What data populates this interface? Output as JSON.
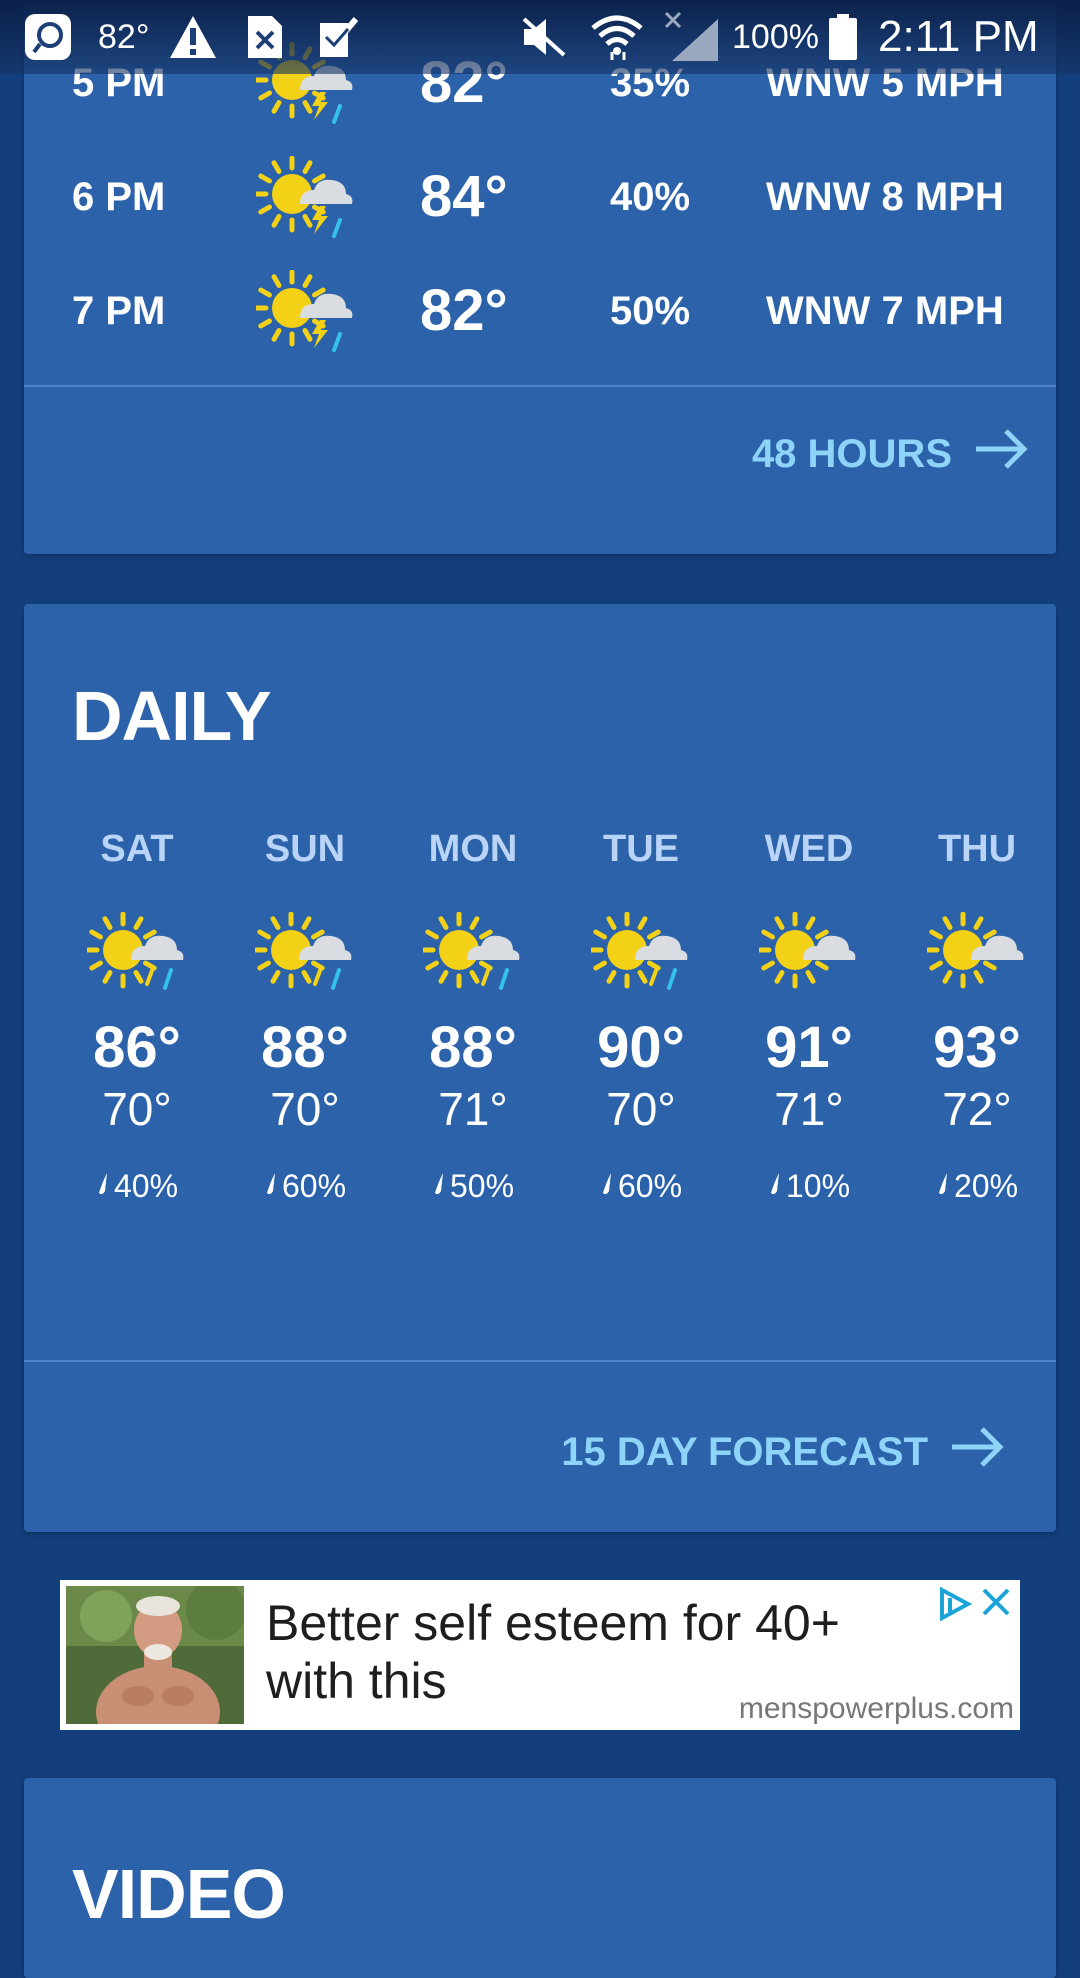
{
  "status_bar": {
    "temp": "82°",
    "battery": "100%",
    "time": "2:11 PM"
  },
  "hourly": {
    "rows": [
      {
        "time": "5 PM",
        "icon": "thunderstorm-sun-icon",
        "temp": "82°",
        "precip": "35%",
        "wind": "WNW 5 MPH"
      },
      {
        "time": "6 PM",
        "icon": "thunderstorm-sun-icon",
        "temp": "84°",
        "precip": "40%",
        "wind": "WNW 8 MPH"
      },
      {
        "time": "7 PM",
        "icon": "thunderstorm-sun-icon",
        "temp": "82°",
        "precip": "50%",
        "wind": "WNW 7 MPH"
      }
    ],
    "link_label": "48 HOURS"
  },
  "daily": {
    "title": "DAILY",
    "days": [
      {
        "day": "SAT",
        "icon": "rain-sun-icon",
        "high": "86°",
        "low": "70°",
        "precip": "40%"
      },
      {
        "day": "SUN",
        "icon": "rain-sun-icon",
        "high": "88°",
        "low": "70°",
        "precip": "60%"
      },
      {
        "day": "MON",
        "icon": "rain-sun-icon",
        "high": "88°",
        "low": "71°",
        "precip": "50%"
      },
      {
        "day": "TUE",
        "icon": "rain-sun-icon",
        "high": "90°",
        "low": "70°",
        "precip": "60%"
      },
      {
        "day": "WED",
        "icon": "partly-cloudy-icon",
        "high": "91°",
        "low": "71°",
        "precip": "10%"
      },
      {
        "day": "THU",
        "icon": "partly-cloudy-icon",
        "high": "93°",
        "low": "72°",
        "precip": "20%"
      }
    ],
    "link_label": "15 DAY FORECAST"
  },
  "ad": {
    "text": "Better self esteem for 40+ with this",
    "domain": "menspowerplus.com"
  },
  "video": {
    "title": "VIDEO"
  },
  "colors": {
    "background": "#133f7d",
    "card": "#2b62aa",
    "link": "#8ed3f8",
    "sun": "#f3d117"
  }
}
